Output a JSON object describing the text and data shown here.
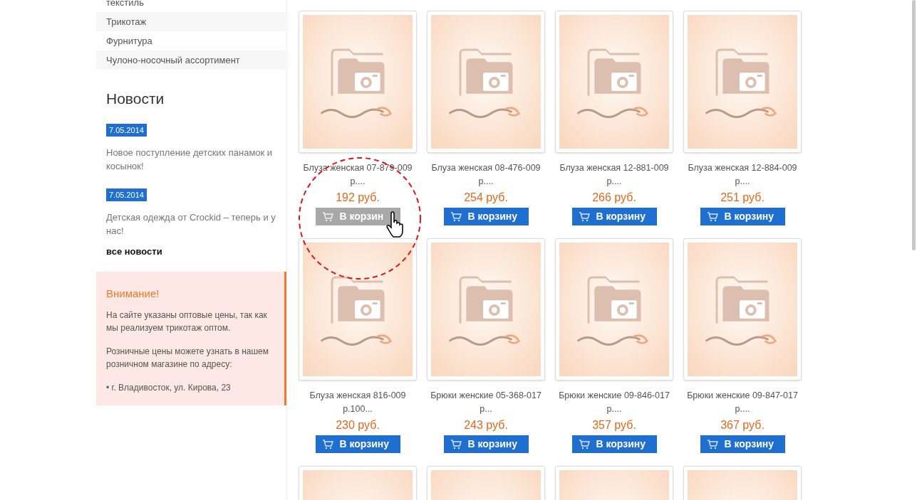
{
  "sidebar": {
    "categories": [
      {
        "label": "текстиль"
      },
      {
        "label": "Трикотаж"
      },
      {
        "label": "Фурнитура"
      },
      {
        "label": "Чулоно-носочный ассортимент"
      }
    ],
    "news_title": "Новости",
    "news": [
      {
        "date": "7.05.2014",
        "text": "Новое поступление детских панамок и косынок!"
      },
      {
        "date": "7.05.2014",
        "text": "Детская одежда от Crockid – теперь и у нас!"
      }
    ],
    "all_news_link": "все новости",
    "notice": {
      "title": "Внимание!",
      "paragraphs": [
        "На сайте указаны оптовые цены, так как мы реализуем трикотаж оптом.",
        "Розничные цены можете узнать в нашем розничном магазине по адресу:",
        "• г. Владивосток, ул. Кирова, 23"
      ]
    }
  },
  "products": [
    {
      "kind": "product",
      "name": "Блуза женская 07-879-009 р....",
      "price": "192 руб.",
      "button": "В корзин",
      "hovered": true
    },
    {
      "kind": "product",
      "name": "Блуза женская 08-476-009 р....",
      "price": "254 руб.",
      "button": "В корзину",
      "hovered": false
    },
    {
      "kind": "product",
      "name": "Блуза женская 12-881-009 р....",
      "price": "266 руб.",
      "button": "В корзину",
      "hovered": false
    },
    {
      "kind": "product",
      "name": "Блуза женская 12-884-009 р....",
      "price": "251 руб.",
      "button": "В корзину",
      "hovered": false
    },
    {
      "kind": "product",
      "name": "Блуза женская 816-009 р.100...",
      "price": "230 руб.",
      "button": "В корзину",
      "hovered": false
    },
    {
      "kind": "product",
      "name": "Брюки женские 05-368-017 р...",
      "price": "243 руб.",
      "button": "В корзину",
      "hovered": false
    },
    {
      "kind": "product",
      "name": "Брюки женские 09-846-017 р....",
      "price": "357 руб.",
      "button": "В корзину",
      "hovered": false
    },
    {
      "kind": "product",
      "name": "Брюки женские 09-847-017 р....",
      "price": "367 руб.",
      "button": "В корзину",
      "hovered": false
    },
    {
      "kind": "picture"
    },
    {
      "kind": "picture"
    },
    {
      "kind": "picture"
    },
    {
      "kind": "picture"
    }
  ]
}
